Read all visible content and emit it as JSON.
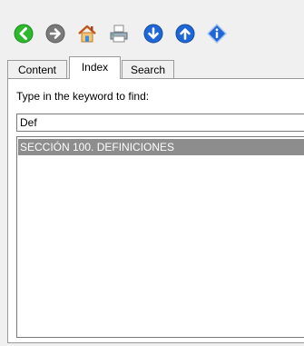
{
  "toolbar": {
    "buttons": [
      {
        "name": "back-button",
        "icon": "arrow-left-circle-icon",
        "color": "#2db82d"
      },
      {
        "name": "forward-button",
        "icon": "arrow-right-circle-icon",
        "color": "#7a7a7a"
      },
      {
        "name": "home-button",
        "icon": "home-icon",
        "color": "#e8892a"
      },
      {
        "name": "print-button",
        "icon": "printer-icon",
        "color": "#6b7c8a"
      },
      {
        "name": "next-topic-button",
        "icon": "arrow-down-circle-icon",
        "color": "#1f66d6"
      },
      {
        "name": "previous-topic-button",
        "icon": "arrow-up-circle-icon",
        "color": "#1f66d6"
      },
      {
        "name": "info-button",
        "icon": "info-diamond-icon",
        "color": "#1f66d6"
      }
    ]
  },
  "tabs": [
    {
      "label": "Content",
      "active": false
    },
    {
      "label": "Index",
      "active": true
    },
    {
      "label": "Search",
      "active": false
    }
  ],
  "index": {
    "prompt": "Type in the keyword to find:",
    "keyword": "Def",
    "results": [
      {
        "label": "SECCIÓN 100.  DEFINICIONES",
        "selected": true
      }
    ]
  },
  "colors": {
    "selection": "#8d8d8d",
    "panel_border": "#9a9a9a"
  }
}
